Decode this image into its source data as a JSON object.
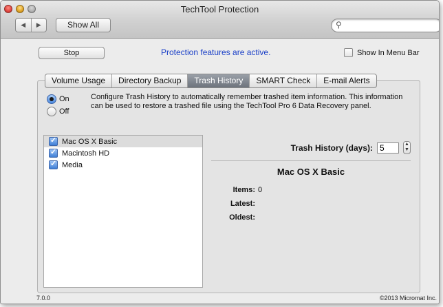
{
  "window": {
    "title": "TechTool Protection"
  },
  "toolbar": {
    "back_label": "◀",
    "forward_label": "▶",
    "show_all_label": "Show All",
    "search_placeholder": ""
  },
  "status": {
    "stop_label": "Stop",
    "message": "Protection features are active.",
    "show_in_menu_bar_label": "Show In Menu Bar",
    "show_in_menu_bar_checked": false
  },
  "tabs": [
    {
      "label": "Volume Usage",
      "selected": false
    },
    {
      "label": "Directory Backup",
      "selected": false
    },
    {
      "label": "Trash History",
      "selected": true
    },
    {
      "label": "SMART Check",
      "selected": false
    },
    {
      "label": "E-mail Alerts",
      "selected": false
    }
  ],
  "trash_history": {
    "on_label": "On",
    "off_label": "Off",
    "selected_option": "On",
    "description": "Configure Trash History to automatically remember trashed item information. This information can be used to restore a trashed file using the TechTool Pro 6 Data Recovery panel.",
    "volumes": [
      {
        "name": "Mac OS X Basic",
        "checked": true,
        "selected": true
      },
      {
        "name": "Macintosh HD",
        "checked": true,
        "selected": false
      },
      {
        "name": "Media",
        "checked": true,
        "selected": false
      }
    ],
    "days_label": "Trash History (days):",
    "days_value": "5",
    "detail": {
      "volume_name": "Mac OS X Basic",
      "items_label": "Items:",
      "items_value": "0",
      "latest_label": "Latest:",
      "latest_value": "",
      "oldest_label": "Oldest:",
      "oldest_value": ""
    }
  },
  "footer": {
    "version": "7.0.0",
    "copyright": "©2013 Micromat Inc."
  },
  "colors": {
    "status_text": "#1a3fc7",
    "selected_tab": "#7a8089",
    "checkbox_checked": "#3f7fd6"
  }
}
